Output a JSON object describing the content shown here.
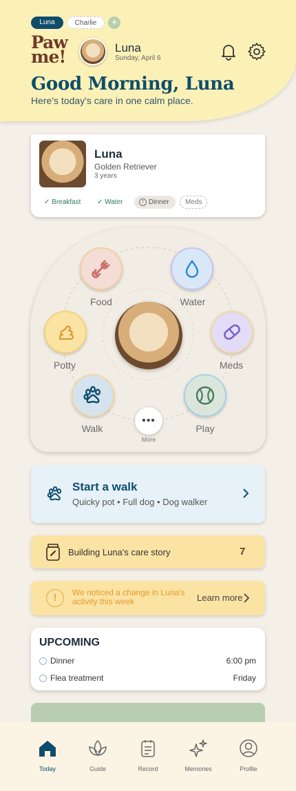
{
  "header": {
    "profiles": [
      "Luna",
      "Charlie"
    ],
    "add_icon": "plus-icon",
    "logo": [
      "Paw",
      "me!"
    ],
    "pet_name": "Luna",
    "date": "Sunday, April 6",
    "greeting": "Good Morning, Luna",
    "subtitle": "Here's today's care in one calm place."
  },
  "pet_card": {
    "name": "Luna",
    "breed": "Golden Retriever",
    "age": "3 years",
    "tasks": [
      {
        "label": "✓ Breakfast",
        "state": "done"
      },
      {
        "label": "✓ Water",
        "state": "done"
      },
      {
        "label": "Dinner",
        "state": "pending"
      },
      {
        "label": "Meds",
        "state": "todo"
      }
    ]
  },
  "care_wheel": {
    "items": [
      {
        "label": "Food",
        "icon": "bone-icon"
      },
      {
        "label": "Water",
        "icon": "water-drop-icon"
      },
      {
        "label": "Potty",
        "icon": "poop-icon"
      },
      {
        "label": "Meds",
        "icon": "pill-icon"
      },
      {
        "label": "Walk",
        "icon": "paw-icon"
      },
      {
        "label": "Play",
        "icon": "ball-icon"
      }
    ],
    "more_label": "More"
  },
  "walk": {
    "title": "Start a walk",
    "subtitle": "Quicky pot • Full dog • Dog walker"
  },
  "story": {
    "label": "Building Luna's care story",
    "count": "7"
  },
  "alert": {
    "text": "We noticed a change in Luna's activity this week",
    "action": "Learn more"
  },
  "upcoming": {
    "title": "UPCOMING",
    "items": [
      {
        "name": "Dinner",
        "when": "6:00 pm"
      },
      {
        "name": "Flea treatment",
        "when": "Friday"
      }
    ]
  },
  "nav": {
    "items": [
      {
        "label": "Today",
        "icon": "home-icon",
        "active": true
      },
      {
        "label": "Guide",
        "icon": "lotus-icon"
      },
      {
        "label": "Record",
        "icon": "record-icon"
      },
      {
        "label": "Memories",
        "icon": "sparkle-icon"
      },
      {
        "label": "Profile",
        "icon": "profile-icon"
      }
    ]
  },
  "colors": {
    "accent": "#0f4d6a",
    "header_bg": "#fbf1b7",
    "warning": "#e7a53a"
  }
}
